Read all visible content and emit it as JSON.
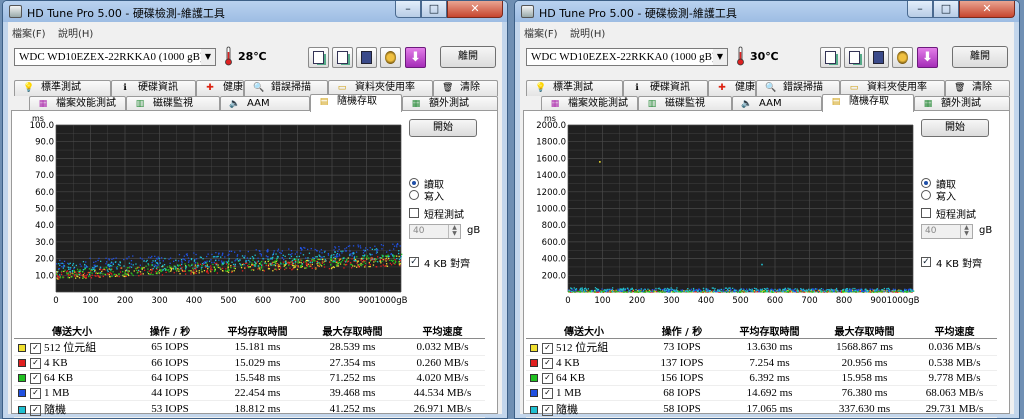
{
  "windows": [
    {
      "title": "HD Tune Pro  5.00 - 硬碟檢測-維護工具",
      "window_buttons": {
        "minimize": "–",
        "maximize": "□",
        "close": "✕"
      },
      "menu": [
        "檔案(F)",
        "說明(H)"
      ],
      "drive": "WDC WD10EZEX-22RKKA0 (1000 gB)",
      "temperature": "28℃",
      "exit_label": "離開",
      "tabs_row1": [
        {
          "label": "標準測試",
          "icon": "bulb-icon",
          "glyph": "💡"
        },
        {
          "label": "硬碟資訊",
          "icon": "info-icon",
          "glyph": "ℹ"
        },
        {
          "label": "健康",
          "icon": "health-cross-icon",
          "glyph": "✚"
        },
        {
          "label": "錯誤掃描",
          "icon": "magnifier-icon",
          "glyph": "🔍"
        },
        {
          "label": "資料夾使用率",
          "icon": "folder-icon",
          "glyph": "▭"
        },
        {
          "label": "清除",
          "icon": "trash-icon",
          "glyph": "🗑"
        }
      ],
      "tabs_row2": [
        {
          "label": "檔案效能測試",
          "icon": "file-benchmark-icon",
          "glyph": "▦"
        },
        {
          "label": "磁碟監視",
          "icon": "disk-monitor-icon",
          "glyph": "▥"
        },
        {
          "label": "AAM",
          "icon": "speaker-icon",
          "glyph": "🔈"
        },
        {
          "label": "隨機存取",
          "icon": "random-access-icon",
          "glyph": "▤",
          "active": true
        },
        {
          "label": "額外測試",
          "icon": "extra-tests-icon",
          "glyph": "▦"
        }
      ],
      "start_label": "開始",
      "read_label": "讀取",
      "write_label": "寫入",
      "short_test_label": "短程測試",
      "short_test_value": "40",
      "short_test_unit": "gB",
      "align_label": "4 KB 對齊",
      "check_mark": "✓",
      "table": {
        "headers": [
          "傳送大小",
          "操作 / 秒",
          "平均存取時間",
          "最大存取時間",
          "平均速度"
        ],
        "rows": [
          {
            "size": "512 位元組",
            "color": "#f0e030",
            "ops": "65 IOPS",
            "avg": "15.181 ms",
            "max": "28.539 ms",
            "speed": "0.032 MB/s"
          },
          {
            "size": "4 KB",
            "color": "#e02020",
            "ops": "66 IOPS",
            "avg": "15.029 ms",
            "max": "27.354 ms",
            "speed": "0.260 MB/s"
          },
          {
            "size": "64 KB",
            "color": "#20c020",
            "ops": "64 IOPS",
            "avg": "15.548 ms",
            "max": "71.252 ms",
            "speed": "4.020 MB/s"
          },
          {
            "size": "1 MB",
            "color": "#2050e0",
            "ops": "44 IOPS",
            "avg": "22.454 ms",
            "max": "39.468 ms",
            "speed": "44.534 MB/s"
          },
          {
            "size": "隨機",
            "color": "#20c0d0",
            "ops": "53 IOPS",
            "avg": "18.812 ms",
            "max": "41.252 ms",
            "speed": "26.971 MB/s"
          }
        ]
      },
      "chart_data": {
        "type": "scatter",
        "ylabel": "ms",
        "xlabel": "gB",
        "y_ticks": [
          "100.0",
          "90.0",
          "80.0",
          "70.0",
          "60.0",
          "50.0",
          "40.0",
          "30.0",
          "20.0",
          "10.0"
        ],
        "x_ticks": [
          "0",
          "100",
          "200",
          "300",
          "400",
          "500",
          "600",
          "700",
          "800",
          "900",
          "1000gB"
        ],
        "xlim": [
          0,
          1000
        ],
        "ylim": [
          0,
          100
        ],
        "grid": true,
        "background": "#202020",
        "gridcolor": "#4a4a4a",
        "series": [
          {
            "color": "#f0e030",
            "band": [
              [
                0,
                8,
                13
              ],
              [
                500,
                12,
                18
              ],
              [
                1000,
                16,
                22
              ]
            ]
          },
          {
            "color": "#e02020",
            "band": [
              [
                0,
                8,
                13
              ],
              [
                500,
                12,
                18
              ],
              [
                1000,
                16,
                22
              ]
            ]
          },
          {
            "color": "#20c020",
            "band": [
              [
                0,
                8,
                14
              ],
              [
                500,
                13,
                19
              ],
              [
                1000,
                17,
                23
              ]
            ]
          },
          {
            "color": "#2050e0",
            "band": [
              [
                0,
                13,
                20
              ],
              [
                500,
                18,
                25
              ],
              [
                1000,
                23,
                30
              ]
            ]
          },
          {
            "color": "#20c0d0",
            "band": [
              [
                0,
                10,
                18
              ],
              [
                500,
                15,
                22
              ],
              [
                1000,
                19,
                27
              ]
            ]
          }
        ]
      }
    },
    {
      "title": "HD Tune Pro  5.00 - 硬碟檢測-維護工具",
      "window_buttons": {
        "minimize": "–",
        "maximize": "□",
        "close": "✕"
      },
      "menu": [
        "檔案(F)",
        "說明(H)"
      ],
      "drive": "WDC WD10EZEX-22RKKA0 (1000 gB)",
      "temperature": "30℃",
      "exit_label": "離開",
      "tabs_row1": [
        {
          "label": "標準測試",
          "icon": "bulb-icon",
          "glyph": "💡"
        },
        {
          "label": "硬碟資訊",
          "icon": "info-icon",
          "glyph": "ℹ"
        },
        {
          "label": "健康",
          "icon": "health-cross-icon",
          "glyph": "✚"
        },
        {
          "label": "錯誤掃描",
          "icon": "magnifier-icon",
          "glyph": "🔍"
        },
        {
          "label": "資料夾使用率",
          "icon": "folder-icon",
          "glyph": "▭"
        },
        {
          "label": "清除",
          "icon": "trash-icon",
          "glyph": "🗑"
        }
      ],
      "tabs_row2": [
        {
          "label": "檔案效能測試",
          "icon": "file-benchmark-icon",
          "glyph": "▦"
        },
        {
          "label": "磁碟監視",
          "icon": "disk-monitor-icon",
          "glyph": "▥"
        },
        {
          "label": "AAM",
          "icon": "speaker-icon",
          "glyph": "🔈"
        },
        {
          "label": "隨機存取",
          "icon": "random-access-icon",
          "glyph": "▤",
          "active": true
        },
        {
          "label": "額外測試",
          "icon": "extra-tests-icon",
          "glyph": "▦"
        }
      ],
      "start_label": "開始",
      "read_label": "讀取",
      "write_label": "寫入",
      "short_test_label": "短程測試",
      "short_test_value": "40",
      "short_test_unit": "gB",
      "align_label": "4 KB 對齊",
      "check_mark": "✓",
      "table": {
        "headers": [
          "傳送大小",
          "操作 / 秒",
          "平均存取時間",
          "最大存取時間",
          "平均速度"
        ],
        "rows": [
          {
            "size": "512 位元組",
            "color": "#f0e030",
            "ops": "73 IOPS",
            "avg": "13.630 ms",
            "max": "1568.867 ms",
            "speed": "0.036 MB/s"
          },
          {
            "size": "4 KB",
            "color": "#e02020",
            "ops": "137 IOPS",
            "avg": "7.254 ms",
            "max": "20.956 ms",
            "speed": "0.538 MB/s"
          },
          {
            "size": "64 KB",
            "color": "#20c020",
            "ops": "156 IOPS",
            "avg": "6.392 ms",
            "max": "15.958 ms",
            "speed": "9.778 MB/s"
          },
          {
            "size": "1 MB",
            "color": "#2050e0",
            "ops": "68 IOPS",
            "avg": "14.692 ms",
            "max": "76.380 ms",
            "speed": "68.063 MB/s"
          },
          {
            "size": "隨機",
            "color": "#20c0d0",
            "ops": "58 IOPS",
            "avg": "17.065 ms",
            "max": "337.630 ms",
            "speed": "29.731 MB/s"
          }
        ]
      },
      "chart_data": {
        "type": "scatter",
        "ylabel": "ms",
        "xlabel": "gB",
        "y_ticks": [
          "2000.0",
          "1800.0",
          "1600.0",
          "1400.0",
          "1200.0",
          "1000.0",
          "800.0",
          "600.0",
          "400.0",
          "200.0"
        ],
        "x_ticks": [
          "0",
          "100",
          "200",
          "300",
          "400",
          "500",
          "600",
          "700",
          "800",
          "900",
          "1000gB"
        ],
        "xlim": [
          0,
          1000
        ],
        "ylim": [
          0,
          2000
        ],
        "grid": true,
        "background": "#202020",
        "gridcolor": "#4a4a4a",
        "series": [
          {
            "color": "#f0e030",
            "band": [
              [
                0,
                5,
                30
              ],
              [
                1000,
                5,
                30
              ]
            ]
          },
          {
            "color": "#e02020",
            "band": [
              [
                0,
                5,
                20
              ],
              [
                1000,
                5,
                20
              ]
            ]
          },
          {
            "color": "#20c020",
            "band": [
              [
                0,
                5,
                18
              ],
              [
                1000,
                5,
                18
              ]
            ]
          },
          {
            "color": "#2050e0",
            "band": [
              [
                0,
                10,
                45
              ],
              [
                1000,
                10,
                45
              ]
            ]
          },
          {
            "color": "#20c0d0",
            "band": [
              [
                0,
                10,
                60
              ],
              [
                1000,
                10,
                50
              ]
            ]
          }
        ],
        "outliers": [
          {
            "x": 90,
            "y": 1568,
            "color": "#f0e030"
          },
          {
            "x": 560,
            "y": 338,
            "color": "#20c0d0"
          }
        ]
      }
    }
  ]
}
